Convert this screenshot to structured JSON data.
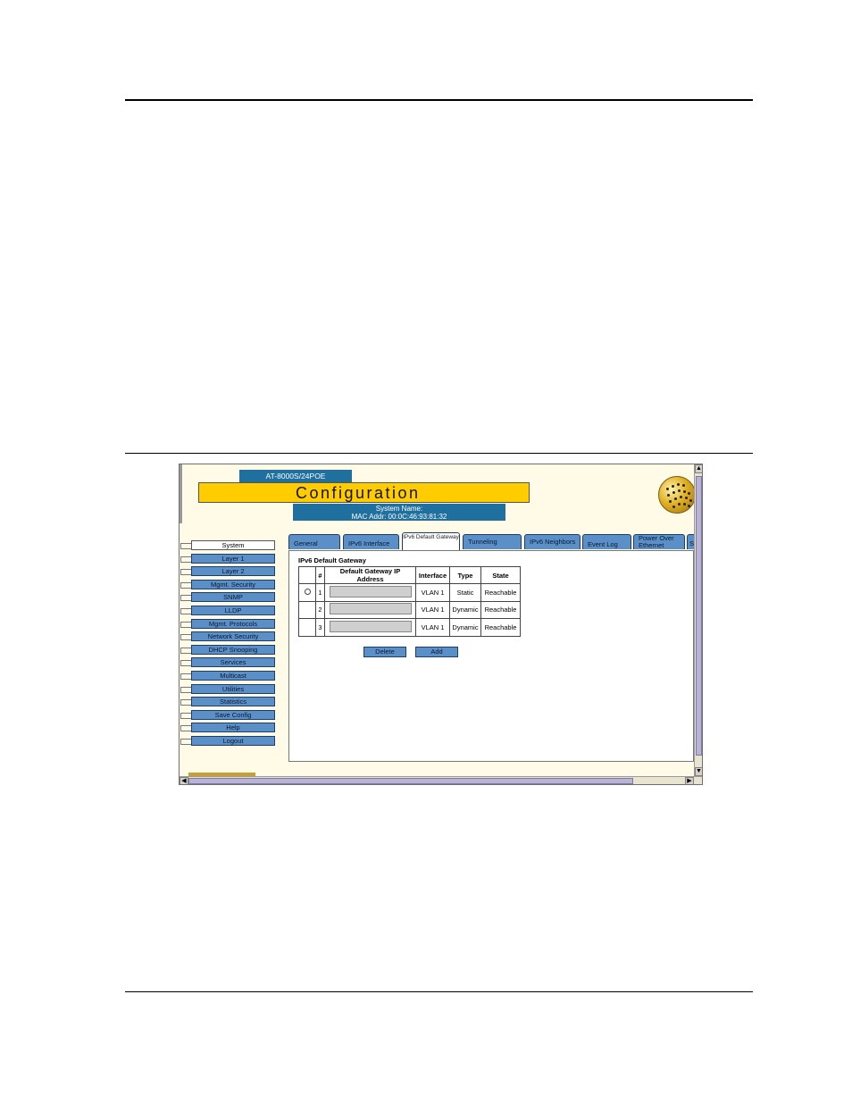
{
  "window": {
    "model": "AT-8000S/24POE",
    "title": "Configuration",
    "system_name": "System Name:",
    "mac_addr": "MAC Addr: 00:0C:46:93:81:32"
  },
  "nav": {
    "items": [
      {
        "label": "System"
      },
      {
        "label": "Layer 1"
      },
      {
        "label": "Layer 2"
      },
      {
        "label": "Mgmt. Security"
      },
      {
        "label": "SNMP"
      },
      {
        "label": "LLDP"
      },
      {
        "label": "Mgmt. Protocols"
      },
      {
        "label": "Network Security"
      },
      {
        "label": "DHCP Snooping"
      },
      {
        "label": "Services"
      },
      {
        "label": "Multicast"
      },
      {
        "label": "Utilities"
      },
      {
        "label": "Statistics"
      },
      {
        "label": "Save Config"
      },
      {
        "label": "Help"
      },
      {
        "label": "Logout"
      }
    ],
    "active": "System"
  },
  "tabs": [
    {
      "label": "General"
    },
    {
      "label": "IPv6 Interface"
    },
    {
      "label": "IPv6 Default Gateway"
    },
    {
      "label": "Tunneling"
    },
    {
      "label": "IPv6 Neighbors"
    },
    {
      "label": "Event Log"
    },
    {
      "label": "Power Over Ethernet"
    },
    {
      "label": "S"
    }
  ],
  "active_tab": "IPv6 Default Gateway",
  "content": {
    "caption": "IPv6 Default Gateway",
    "columns": [
      "#",
      "Default Gateway IP Address",
      "Interface",
      "Type",
      "State"
    ],
    "rows": [
      {
        "num": "1",
        "ip": "",
        "interface": "VLAN 1",
        "type": "Static",
        "state": "Reachable"
      },
      {
        "num": "2",
        "ip": "",
        "interface": "VLAN 1",
        "type": "Dynamic",
        "state": "Reachable"
      },
      {
        "num": "3",
        "ip": "",
        "interface": "VLAN 1",
        "type": "Dynamic",
        "state": "Reachable"
      }
    ],
    "delete_label": "Delete",
    "add_label": "Add"
  },
  "icons": {
    "scroll_up": "scroll-up-arrow-icon",
    "scroll_down": "scroll-down-arrow-icon",
    "scroll_left": "scroll-left-arrow-icon",
    "scroll_right": "scroll-right-arrow-icon",
    "logo": "globe-logo-icon"
  },
  "colors": {
    "accent_blue": "#5b8fc7",
    "header_blue": "#1f6f9f",
    "title_yellow": "#ffcc00",
    "background": "#fffbe6"
  }
}
